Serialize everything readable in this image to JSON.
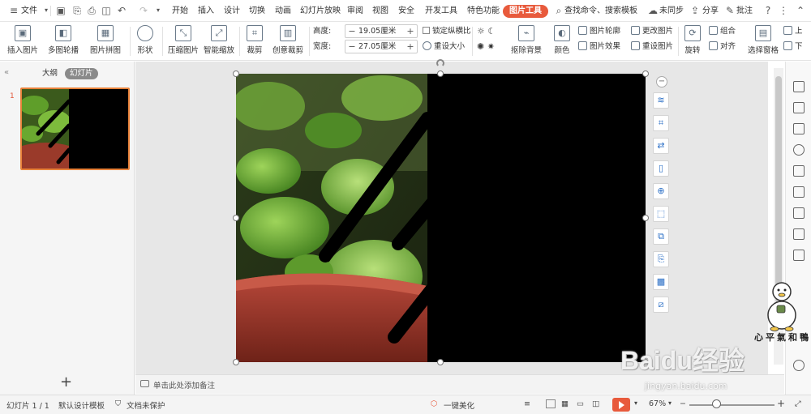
{
  "menubar": {
    "file_label": "文件",
    "tabs": [
      "开始",
      "插入",
      "设计",
      "切换",
      "动画",
      "幻灯片放映",
      "审阅",
      "视图",
      "安全",
      "开发工具",
      "特色功能",
      "图片工具"
    ],
    "active_tab": "图片工具",
    "search_label": "查找命令、搜索模板",
    "sync_label": "未同步",
    "share_label": "分享",
    "comment_label": "批注"
  },
  "toolbar": {
    "insert_picture": "插入图片",
    "multi_outline": "多图轮播",
    "picture_collage": "图片拼图",
    "shape": "形状",
    "compress": "压缩图片",
    "smart_zoom": "智能缩放",
    "crop": "裁剪",
    "creative_crop": "创意裁剪",
    "height_label": "高度:",
    "height_value": "19.05厘米",
    "width_label": "宽度:",
    "width_value": "27.05厘米",
    "lock_ratio": "锁定纵横比",
    "reset_size": "重设大小",
    "remove_bg": "抠除背景",
    "color": "颜色",
    "picture_outline": "图片轮廓",
    "picture_effect": "图片效果",
    "change_picture": "更改图片",
    "reset_picture": "重设图片",
    "rotate": "旋转",
    "group": "组合",
    "align": "对齐",
    "selection_pane": "选择窗格",
    "up": "上",
    "down": "下"
  },
  "left_panel": {
    "tab_outline": "大纲",
    "tab_slides": "幻灯片",
    "slide_number": "1"
  },
  "notes": {
    "placeholder": "单击此处添加备注"
  },
  "statusbar": {
    "slide_info": "幻灯片 1 / 1",
    "template": "默认设计模板",
    "doc_status": "文档未保护",
    "beautify": "一键美化",
    "zoom": "67%"
  },
  "watermark": {
    "author": "心平氣和鴨",
    "baidu_logo": "Baidu经验",
    "baidu_url": "jingyan.baidu.com"
  },
  "colors": {
    "accent": "#e85a3c",
    "selection_border": "#e8823a"
  }
}
